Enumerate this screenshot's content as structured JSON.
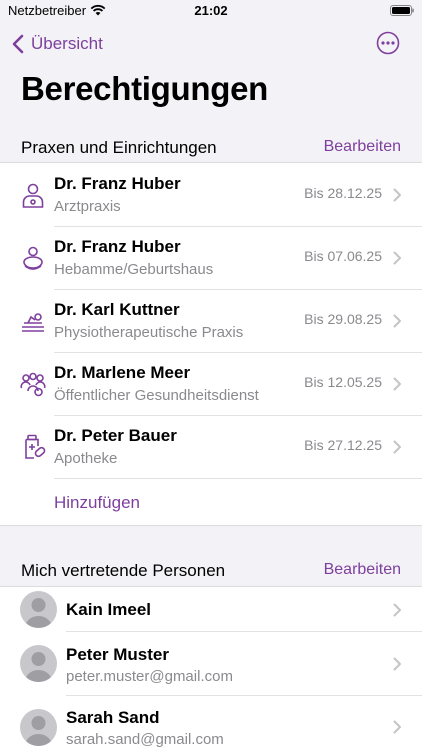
{
  "status_bar": {
    "carrier": "Netzbetreiber",
    "time": "21:02"
  },
  "nav": {
    "back_label": "Übersicht"
  },
  "page_title": "Berechtigungen",
  "practices": {
    "header": "Praxen und Einrichtungen",
    "edit_label": "Bearbeiten",
    "items": [
      {
        "name": "Dr. Franz Huber",
        "type": "Arztpraxis",
        "until": "Bis 28.12.25",
        "icon": "doctor-icon"
      },
      {
        "name": "Dr. Franz Huber",
        "type": "Hebamme/Geburtshaus",
        "until": "Bis 07.06.25",
        "icon": "midwife-icon"
      },
      {
        "name": "Dr. Karl Kuttner",
        "type": "Physiotherapeutische Praxis",
        "until": "Bis 29.08.25",
        "icon": "physiotherapy-icon"
      },
      {
        "name": "Dr. Marlene Meer",
        "type": "Öffentlicher Gesundheitsdienst",
        "until": "Bis 12.05.25",
        "icon": "public-health-icon"
      },
      {
        "name": "Dr. Peter Bauer",
        "type": "Apotheke",
        "until": "Bis 27.12.25",
        "icon": "pharmacy-icon"
      }
    ],
    "add_label": "Hinzufügen"
  },
  "representatives": {
    "header": "Mich vertretende Personen",
    "edit_label": "Bearbeiten",
    "items": [
      {
        "name": "Kain Imeel",
        "email": ""
      },
      {
        "name": "Peter Muster",
        "email": "peter.muster@gmail.com"
      },
      {
        "name": "Sarah Sand",
        "email": "sarah.sand@gmail.com"
      }
    ]
  },
  "colors": {
    "accent": "#7e3f9d",
    "background": "#f2f2f7",
    "secondary_text": "#8a8a8e"
  }
}
